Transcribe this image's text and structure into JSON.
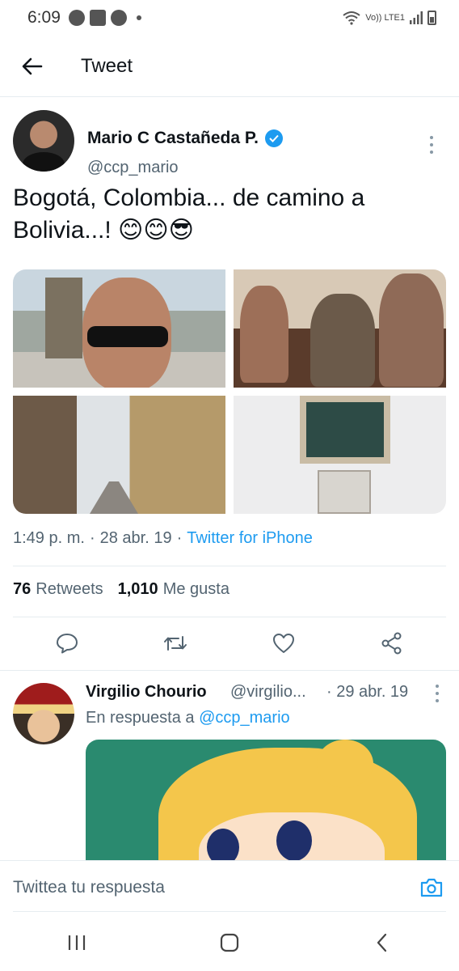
{
  "status_bar": {
    "time": "6:09",
    "network_label": "Vo)) LTE1"
  },
  "header": {
    "title": "Tweet"
  },
  "tweet": {
    "author_name": "Mario C Castañeda P.",
    "author_handle": "@ccp_mario",
    "text": "Bogotá, Colombia... de camino a Bolivia...! 😊😊😎",
    "time": "1:49 p. m.",
    "date": "28 abr. 19",
    "source": "Twitter for iPhone",
    "separator": "·",
    "retweets_count": "76",
    "retweets_label": "Retweets",
    "likes_count": "1,010",
    "likes_label": "Me gusta"
  },
  "reply": {
    "author_name": "Virgilio Chourio",
    "author_handle": "@virgilio...",
    "date": "· 29 abr. 19",
    "reply_to_prefix": "En respuesta a",
    "reply_to_handle": "@ccp_mario"
  },
  "compose": {
    "placeholder": "Twittea tu respuesta"
  },
  "colors": {
    "accent": "#1d9bf0",
    "text_primary": "#0f1419",
    "text_secondary": "#536471",
    "divider": "#e6ecf0"
  }
}
